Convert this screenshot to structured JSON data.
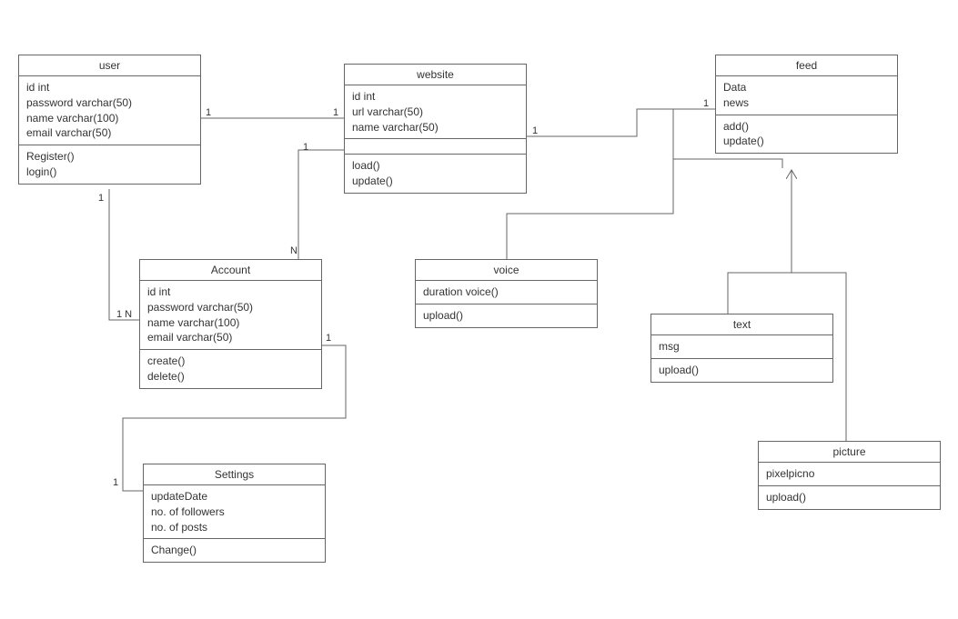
{
  "classes": {
    "user": {
      "title": "user",
      "attrs": [
        "id int",
        "password varchar(50)",
        "name varchar(100)",
        "email varchar(50)"
      ],
      "ops": [
        "Register()",
        "login()"
      ]
    },
    "website": {
      "title": "website",
      "attrs": [
        "id int",
        "url varchar(50)",
        "name varchar(50)"
      ],
      "ops": [
        "load()",
        "update()"
      ]
    },
    "feed": {
      "title": "feed",
      "attrs": [
        "Data",
        "news"
      ],
      "ops": [
        "add()",
        "update()"
      ]
    },
    "account": {
      "title": "Account",
      "attrs": [
        "id int",
        "password varchar(50)",
        "name varchar(100)",
        "email varchar(50)"
      ],
      "ops": [
        "create()",
        "delete()"
      ]
    },
    "voice": {
      "title": "voice",
      "attrs": [
        "duration voice()"
      ],
      "ops": [
        "upload()"
      ]
    },
    "text": {
      "title": "text",
      "attrs": [
        "msg"
      ],
      "ops": [
        "upload()"
      ]
    },
    "picture": {
      "title": "picture",
      "attrs": [
        "pixelpicno"
      ],
      "ops": [
        "upload()"
      ]
    },
    "settings": {
      "title": "Settings",
      "attrs": [
        "updateDate",
        "no. of followers",
        "no. of posts"
      ],
      "ops": [
        "Change()"
      ]
    }
  },
  "multiplicities": {
    "user_website_left": "1",
    "user_website_right": "1",
    "website_feed_left": "1",
    "website_feed_right": "1",
    "user_account_top": "1",
    "user_account_bottom": "1 N",
    "website_account_top": "1",
    "website_account_bottom": "N",
    "account_settings_top": "1",
    "account_settings_bottom": "1"
  },
  "relationships": [
    {
      "from": "user",
      "to": "website",
      "type": "association",
      "mult": "1..1"
    },
    {
      "from": "website",
      "to": "feed",
      "type": "association",
      "mult": "1..1"
    },
    {
      "from": "user",
      "to": "Account",
      "type": "association",
      "mult": "1..1N"
    },
    {
      "from": "website",
      "to": "Account",
      "type": "association",
      "mult": "1..N"
    },
    {
      "from": "Account",
      "to": "Settings",
      "type": "association",
      "mult": "1..1"
    },
    {
      "from": "voice",
      "to": "feed",
      "type": "generalization"
    },
    {
      "from": "text",
      "to": "feed",
      "type": "generalization"
    },
    {
      "from": "picture",
      "to": "feed",
      "type": "generalization"
    }
  ]
}
